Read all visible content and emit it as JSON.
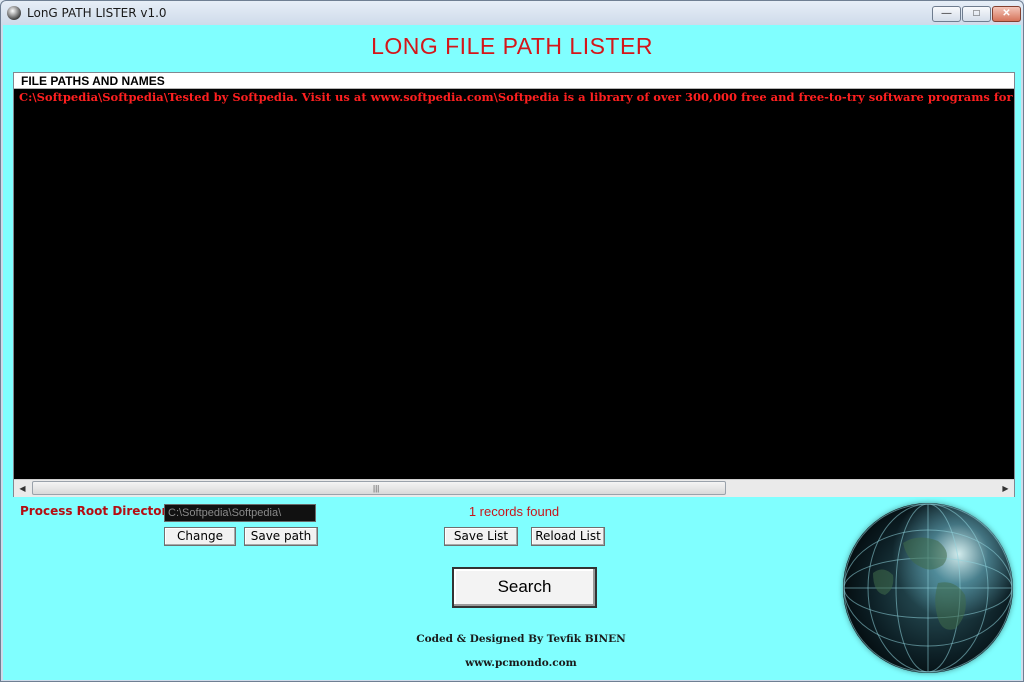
{
  "window": {
    "title": "LonG PATH LISTER v1.0",
    "controls": {
      "minimize": "—",
      "maximize": "□",
      "close": "✕"
    }
  },
  "app": {
    "title": "LONG FILE PATH LISTER"
  },
  "list": {
    "header": "FILE PATHS AND NAMES",
    "rows": [
      "C:\\Softpedia\\Softpedia\\Tested by Softpedia. Visit us at www.softpedia.com\\Softpedia is a library of over 300,000 free and free-to-try software programs for Windows and Linux"
    ],
    "scroll_grip": "|||"
  },
  "controls": {
    "root_label": "Process Root Directory:",
    "root_value": "C:\\Softpedia\\Softpedia\\",
    "change_label": "Change",
    "save_path_label": "Save path",
    "records_text": "1 records found",
    "save_list_label": "Save List",
    "reload_list_label": "Reload List",
    "search_label": "Search"
  },
  "footer": {
    "credit": "Coded & Designed By Tevfik BINEN",
    "website": "www.pcmondo.com"
  },
  "colors": {
    "background": "#80ffff",
    "accent_red": "#d4161a",
    "list_bg": "#000000"
  },
  "icons": {
    "app": "globe-icon",
    "decoration": "earth-globe"
  }
}
